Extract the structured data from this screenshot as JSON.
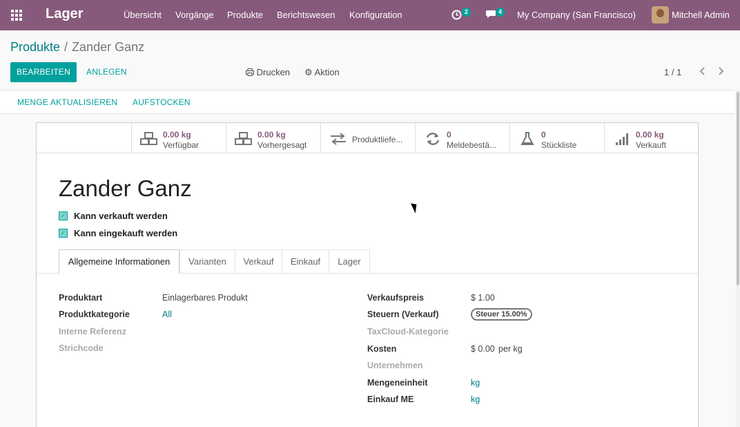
{
  "navbar": {
    "app_name": "Lager",
    "menu": [
      "Übersicht",
      "Vorgänge",
      "Produkte",
      "Berichtswesen",
      "Konfiguration"
    ],
    "activity_count": "2",
    "message_count": "4",
    "company": "My Company (San Francisco)",
    "user": "Mitchell Admin",
    "colors": {
      "bar": "#875a7b",
      "badge": "#00a09d"
    }
  },
  "breadcrumb": {
    "parent": "Produkte",
    "separator": "/",
    "current": "Zander Ganz"
  },
  "buttons": {
    "edit": "BEARBEITEN",
    "create": "ANLEGEN",
    "print": "Drucken",
    "action": "Aktion"
  },
  "pager": {
    "value": "1 / 1"
  },
  "statusbar": {
    "update_qty": "MENGE AKTUALISIEREN",
    "replenish": "AUFSTOCKEN"
  },
  "smart_buttons": [
    {
      "icon": "cubes-icon",
      "value": "0.00 kg",
      "label": "Verfügbar"
    },
    {
      "icon": "cubes-icon",
      "value": "0.00 kg",
      "label": "Vorhergesagt"
    },
    {
      "icon": "exchange-icon",
      "label": "Produktliefe..."
    },
    {
      "icon": "refresh-icon",
      "value": "0",
      "label": "Meldebestä..."
    },
    {
      "icon": "flask-icon",
      "value": "0",
      "label": "Stückliste"
    },
    {
      "icon": "signal-icon",
      "value": "0.00 kg",
      "label": "Verkauft"
    }
  ],
  "product": {
    "name": "Zander Ganz",
    "can_be_sold": "Kann verkauft werden",
    "can_be_purchased": "Kann eingekauft werden"
  },
  "tabs": [
    "Allgemeine Informationen",
    "Varianten",
    "Verkauf",
    "Einkauf",
    "Lager"
  ],
  "left_fields": [
    {
      "label": "Produktart",
      "value": "Einlagerbares Produkt"
    },
    {
      "label": "Produktkategorie",
      "value": "All"
    },
    {
      "label": "Interne Referenz",
      "value": ""
    },
    {
      "label": "Strichcode",
      "value": ""
    }
  ],
  "right_fields": {
    "sale_price": {
      "label": "Verkaufspreis",
      "value": "$ 1.00"
    },
    "taxes": {
      "label": "Steuern (Verkauf)",
      "value": "Steuer 15.00%"
    },
    "taxcloud": {
      "label": "TaxCloud-Kategorie",
      "value": ""
    },
    "cost": {
      "label": "Kosten",
      "value": "$ 0.00",
      "unit": "per kg"
    },
    "company": {
      "label": "Unternehmen",
      "value": ""
    },
    "uom": {
      "label": "Mengeneinheit",
      "value": "kg"
    },
    "purchase_uom": {
      "label": "Einkauf ME",
      "value": "kg"
    }
  }
}
